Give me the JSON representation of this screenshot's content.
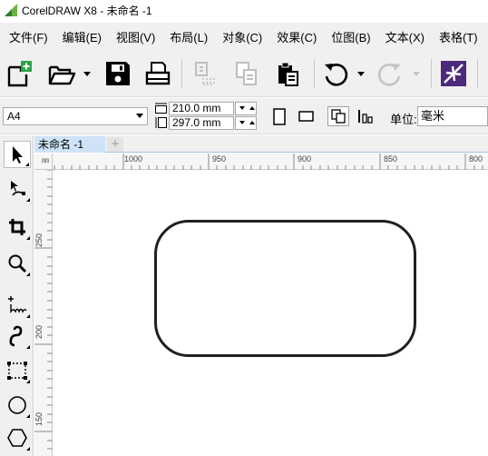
{
  "window": {
    "title": "CorelDRAW X8 - 未命名 -1"
  },
  "menu": [
    {
      "label": "文件(F)",
      "name": "menu-file"
    },
    {
      "label": "编辑(E)",
      "name": "menu-edit"
    },
    {
      "label": "视图(V)",
      "name": "menu-view"
    },
    {
      "label": "布局(L)",
      "name": "menu-layout"
    },
    {
      "label": "对象(C)",
      "name": "menu-object"
    },
    {
      "label": "效果(C)",
      "name": "menu-effects"
    },
    {
      "label": "位图(B)",
      "name": "menu-bitmaps"
    },
    {
      "label": "文本(X)",
      "name": "menu-text"
    },
    {
      "label": "表格(T)",
      "name": "menu-table"
    }
  ],
  "toolbar": {
    "icons": [
      "new-document-icon",
      "open-folder-icon",
      "save-icon",
      "print-icon",
      "cut-icon",
      "copy-icon",
      "paste-icon",
      "undo-icon",
      "redo-icon",
      "import-icon"
    ]
  },
  "properties": {
    "page_size": "A4",
    "width": "210.0 mm",
    "height": "297.0 mm",
    "unit_label": "单位:",
    "unit_value": "毫米"
  },
  "document_tab": {
    "label": "未命名 -1",
    "new_tab_label": "+"
  },
  "ruler": {
    "top_labels": [
      "1000",
      "950",
      "900",
      "850",
      "800"
    ],
    "left_labels": [
      "250",
      "200",
      "150"
    ],
    "corner_label": "㎜"
  },
  "tools": [
    "pick-tool-icon",
    "shape-tool-icon",
    "crop-tool-icon",
    "zoom-tool-icon",
    "freehand-tool-icon",
    "artistic-media-tool-icon",
    "rectangle-tool-icon",
    "ellipse-tool-icon",
    "polygon-tool-icon"
  ],
  "colors": {
    "accent": "#cfe3f8",
    "shape_stroke": "#231f20",
    "app_icon_green": "#6cb33f"
  }
}
